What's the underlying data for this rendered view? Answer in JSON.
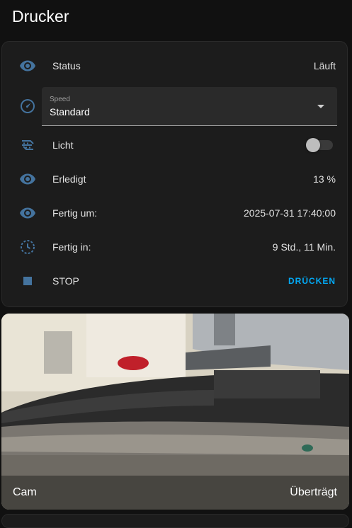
{
  "section": {
    "title": "Drucker"
  },
  "colors": {
    "accent": "#03a9f4",
    "icon": "#44739e",
    "card": "#1c1c1c",
    "background": "#111111"
  },
  "rows": {
    "status": {
      "icon": "eye-icon",
      "label": "Status",
      "value": "Läuft"
    },
    "speed": {
      "icon": "speedometer-icon",
      "label": "Speed",
      "value": "Standard"
    },
    "light": {
      "icon": "led-strip-icon",
      "label": "Licht",
      "state": "off"
    },
    "done": {
      "icon": "eye-icon",
      "label": "Erledigt",
      "value": "13 %"
    },
    "finish_at": {
      "icon": "eye-icon",
      "label": "Fertig um:",
      "value": "2025-07-31 17:40:00"
    },
    "finish_in": {
      "icon": "timer-icon",
      "label": "Fertig in:",
      "value": "9 Std., 11 Min."
    },
    "stop": {
      "icon": "stop-icon",
      "label": "STOP",
      "action": "DRÜCKEN"
    }
  },
  "camera": {
    "name": "Cam",
    "state": "Überträgt"
  }
}
